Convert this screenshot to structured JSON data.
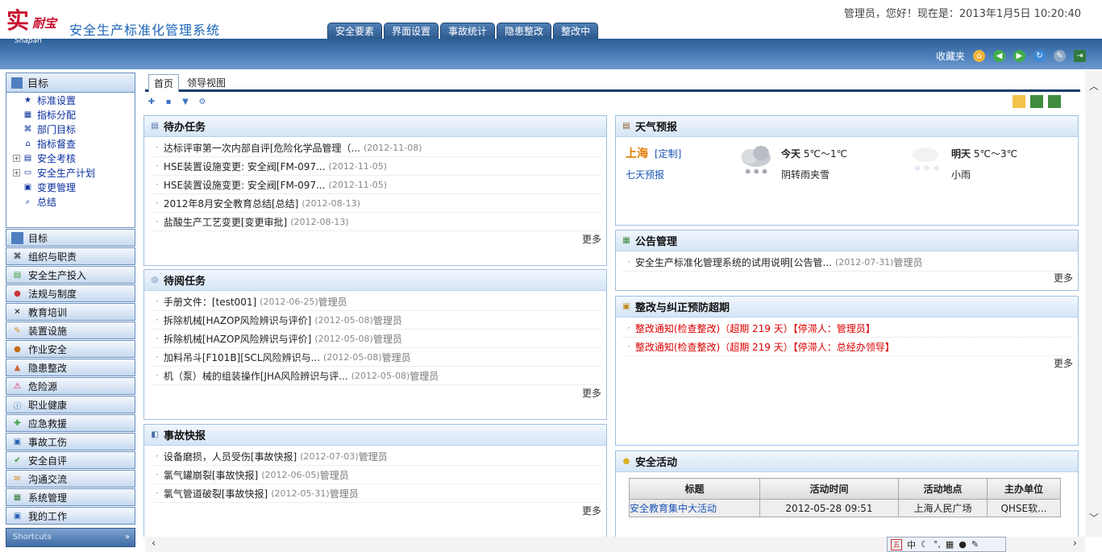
{
  "app": {
    "logo_mark": "实",
    "logo_text": "耐宝",
    "logo_sub": "Snapan",
    "name": "安全生产标准化管理系统",
    "greeting": "管理员，您好！现在是：2013年1月5日  10:20:40"
  },
  "nav_tabs": [
    "安全要素",
    "界面设置",
    "事故统计",
    "隐患整改",
    "整改中"
  ],
  "toolbar": {
    "favorites": "收藏夹"
  },
  "tree": {
    "title": "目标",
    "items": [
      "标准设置",
      "指标分配",
      "部门目标",
      "指标督查",
      "安全考核",
      "安全生产计划",
      "变更管理",
      "总结"
    ]
  },
  "sidebar_buttons": [
    "目标",
    "组织与职责",
    "安全生产投入",
    "法规与制度",
    "教育培训",
    "装置设施",
    "作业安全",
    "隐患整改",
    "危险源",
    "职业健康",
    "应急救援",
    "事故工伤",
    "安全自评",
    "沟通交流",
    "系统管理",
    "我的工作"
  ],
  "sidebar_footer": "Shortcuts",
  "tabs": [
    "首页",
    "领导视图"
  ],
  "more_label": "更多",
  "todo": {
    "title": "待办任务",
    "items": [
      {
        "t": "达标评审第一次内部自评[危险化学品管理（...",
        "d": "(2012-11-08)"
      },
      {
        "t": "HSE装置设施变更: 安全阀[FM-097...",
        "d": "(2012-11-05)"
      },
      {
        "t": "HSE装置设施变更: 安全阀[FM-097...",
        "d": "(2012-11-05)"
      },
      {
        "t": "2012年8月安全教育总结[总结]",
        "d": "(2012-08-13)"
      },
      {
        "t": "盐酸生产工艺变更[变更审批]",
        "d": "(2012-08-13)"
      }
    ]
  },
  "toread": {
    "title": "待阅任务",
    "items": [
      {
        "t": "手册文件：[test001]",
        "d": "(2012-06-25)",
        "u": "管理员"
      },
      {
        "t": "拆除机械[HAZOP风险辨识与评价]",
        "d": "(2012-05-08)",
        "u": "管理员"
      },
      {
        "t": "拆除机械[HAZOP风险辨识与评价]",
        "d": "(2012-05-08)",
        "u": "管理员"
      },
      {
        "t": "加料吊斗[F101B][SCL风险辨识与...",
        "d": "(2012-05-08)",
        "u": "管理员"
      },
      {
        "t": "机（泵）械的组装操作[JHA风险辨识与评...",
        "d": "(2012-05-08)",
        "u": "管理员"
      }
    ]
  },
  "accident": {
    "title": "事故快报",
    "items": [
      {
        "t": "设备磨损，人员受伤[事故快报]",
        "d": "(2012-07-03)",
        "u": "管理员"
      },
      {
        "t": "氯气罐崩裂[事故快报]",
        "d": "(2012-06-05)",
        "u": "管理员"
      },
      {
        "t": "氯气管道破裂[事故快报]",
        "d": "(2012-05-31)",
        "u": "管理员"
      }
    ]
  },
  "weather": {
    "title": "天气预报",
    "city": "上海",
    "custom": "[定制]",
    "seven": "七天预报",
    "today_label": "今天",
    "today_temp": "5℃～1℃",
    "today_desc": "阴转雨夹雪",
    "tom_label": "明天",
    "tom_temp": "5℃～3℃",
    "tom_desc": "小雨"
  },
  "notice": {
    "title": "公告管理",
    "items": [
      {
        "t": "安全生产标准化管理系统的试用说明[公告管...",
        "d": "(2012-07-31)",
        "u": "管理员"
      }
    ]
  },
  "rectify": {
    "title": "整改与纠正预防超期",
    "items": [
      "整改通知(检查整改)（超期 219 天）【停滞人：管理员】",
      "整改通知(检查整改)（超期 219 天）【停滞人：总经办领导】"
    ]
  },
  "activity": {
    "title": "安全活动",
    "headers": [
      "标题",
      "活动时间",
      "活动地点",
      "主办单位"
    ],
    "rows": [
      [
        "安全教育集中大活动",
        "2012-05-28 09:51",
        "上海人民广场",
        "QHSE软..."
      ]
    ]
  },
  "ime": "中"
}
